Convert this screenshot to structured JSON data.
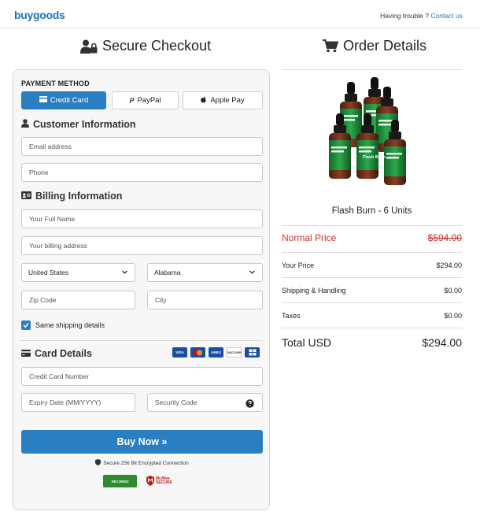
{
  "header": {
    "logo_buy": "buy",
    "logo_goods": "goods",
    "trouble_text": "Having trouble ?",
    "contact_link": "Contact us"
  },
  "checkout": {
    "title": "Secure Checkout",
    "payment_method_label": "PAYMENT METHOD",
    "payment_methods": [
      {
        "label": "Credit Card",
        "active": true
      },
      {
        "label": "PayPal",
        "active": false
      },
      {
        "label": "Apple Pay",
        "active": false
      }
    ],
    "customer_info_title": "Customer Information",
    "email_placeholder": "Email address",
    "phone_placeholder": "Phone",
    "billing_info_title": "Billing Information",
    "full_name_placeholder": "Your Full Name",
    "billing_address_placeholder": "Your billing address",
    "country_value": "United States",
    "state_value": "Alabama",
    "zip_placeholder": "Zip Code",
    "city_placeholder": "City",
    "same_shipping_label": "Same shipping details",
    "same_shipping_checked": true,
    "card_details_title": "Card Details",
    "card_brands": [
      "VISA",
      "mastercard",
      "AMEX",
      "DISCOVER",
      "DINERS"
    ],
    "card_number_placeholder": "Credit Card Number",
    "expiry_placeholder": "Expiry Date (MM/YYYY)",
    "security_code_placeholder": "Security Code",
    "buy_button": "Buy Now »",
    "secure_note": "Secure 256 Bit Encrypted Connection",
    "badge_secured": "SECURED",
    "badge_mcafee": "McAfee SECURE"
  },
  "order": {
    "title": "Order Details",
    "product_name": "Flash Burn - 6 Units",
    "bottle_label": "Flash Burn",
    "normal_price_label": "Normal Price",
    "normal_price_value": "$594.00",
    "your_price_label": "Your Price",
    "your_price_value": "$294.00",
    "shipping_label": "Shipping & Handling",
    "shipping_value": "$0.00",
    "taxes_label": "Taxes",
    "taxes_value": "$0.00",
    "total_label": "Total USD",
    "total_value": "$294.00"
  },
  "colors": {
    "accent": "#2a7fc2",
    "brand": "#1e73be",
    "strike_red": "#d0312d"
  }
}
